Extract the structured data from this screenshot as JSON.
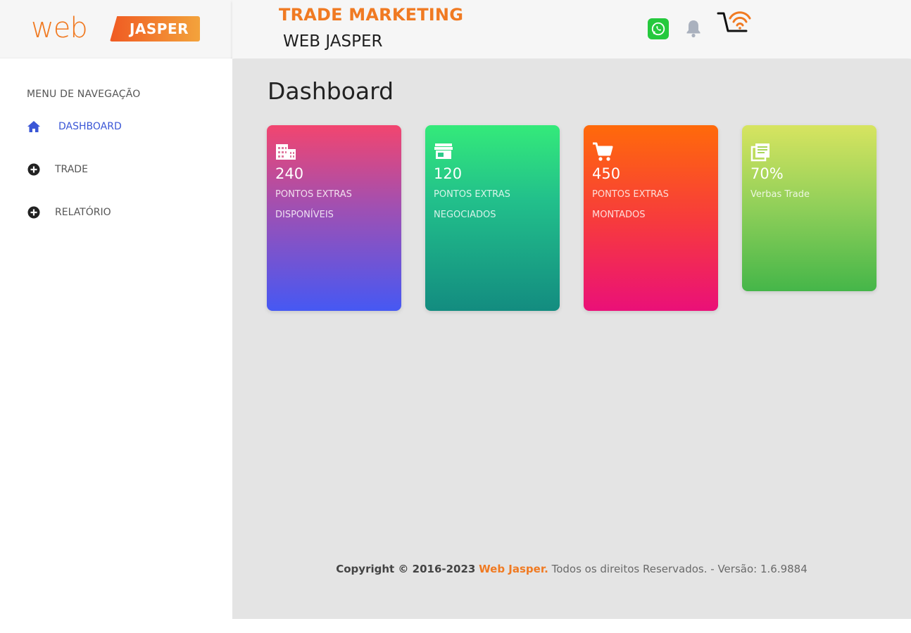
{
  "brand": {
    "logo_web": "web",
    "logo_jasper": "JASPER"
  },
  "header": {
    "title": "TRADE MARKETING",
    "subtitle": "WEB JASPER",
    "icons": [
      "whatsapp-icon",
      "bell-icon",
      "cart-wifi-icon"
    ]
  },
  "sidebar": {
    "menu_title": "MENU DE NAVEGAÇÃO",
    "items": [
      {
        "label": "DASHBOARD",
        "icon": "home-icon",
        "active": true
      },
      {
        "label": "TRADE",
        "icon": "plus-circle-icon",
        "active": false
      },
      {
        "label": "RELATÓRIO",
        "icon": "plus-circle-icon",
        "active": false
      }
    ]
  },
  "main": {
    "page_title": "Dashboard",
    "cards": [
      {
        "value": "240",
        "label_line1": "PONTOS EXTRAS",
        "label_line2": "DISPONÍVEIS",
        "icon": "building-icon",
        "gradient": [
          "#f2456f",
          "#4658f3"
        ]
      },
      {
        "value": "120",
        "label_line1": "PONTOS EXTRAS",
        "label_line2": "NEGOCIADOS",
        "icon": "store-icon",
        "gradient": [
          "#34ea7a",
          "#138c80"
        ]
      },
      {
        "value": "450",
        "label_line1": "PONTOS EXTRAS",
        "label_line2": "MONTADOS",
        "icon": "cart-icon",
        "gradient": [
          "#ff6a0a",
          "#ea1078"
        ]
      },
      {
        "value": "70%",
        "label_line1": "Verbas Trade",
        "label_line2": "",
        "icon": "library-icon",
        "gradient": [
          "#d7e460",
          "#45b649"
        ]
      }
    ]
  },
  "footer": {
    "copyright": "Copyright © 2016-2023",
    "brand": "Web Jasper.",
    "text": "Todos os direitos Reservados. - Versão: 1.6.9884"
  },
  "colors": {
    "accent": "#f07a22",
    "active_nav": "#3a56d6",
    "main_bg": "#e4e4e4"
  }
}
